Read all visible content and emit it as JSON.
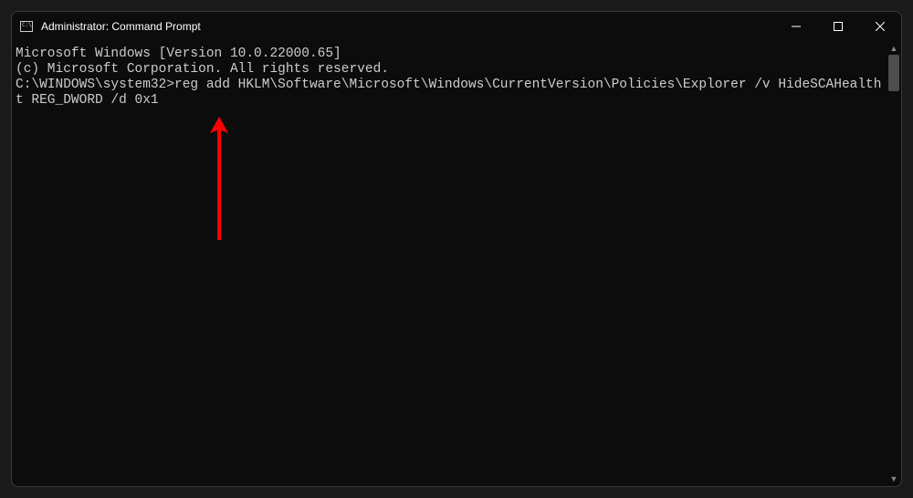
{
  "titlebar": {
    "title": "Administrator: Command Prompt"
  },
  "terminal": {
    "line1": "Microsoft Windows [Version 10.0.22000.65]",
    "line2": "(c) Microsoft Corporation. All rights reserved.",
    "blank": "",
    "prompt": "C:\\WINDOWS\\system32>",
    "command": "reg add HKLM\\Software\\Microsoft\\Windows\\CurrentVersion\\Policies\\Explorer /v HideSCAHealth /t REG_DWORD /d 0x1"
  },
  "annotation": {
    "arrow_color": "#ff0000"
  }
}
